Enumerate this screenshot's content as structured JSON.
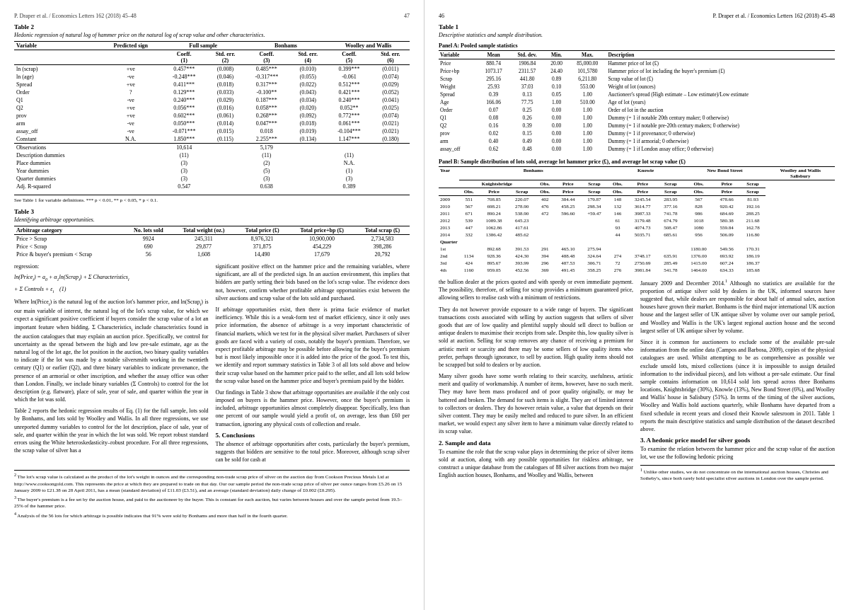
{
  "left_page": {
    "header": {
      "left": "P. Draper et al. / Economics Letters 162 (2018) 45–48",
      "right": "47"
    },
    "table2": {
      "title": "Table 2",
      "caption": "Hedonic regression of natural log of hammer price on the natural log of scrap value and other characteristics.",
      "columns": [
        "Variable",
        "Predicted sign",
        "Full sample Coeff. (1)",
        "Full sample Std. err. (2)",
        "Bonhams Coeff. (3)",
        "Bonhams Std. err. (4)",
        "Woolley and Wallis Coeff. (5)",
        "Woolley and Wallis Std. err. (6)"
      ],
      "rows": [
        [
          "ln (scrap)",
          "+ve",
          "0.457***",
          "(0.008)",
          "0.485***",
          "(0.010)",
          "0.399***",
          "(0.011)"
        ],
        [
          "ln (age)",
          "-ve",
          "-0.248***",
          "(0.046)",
          "-0.317***",
          "(0.055)",
          "-0.061",
          "(0.074)"
        ],
        [
          "Spread",
          "+ve",
          "0.411***",
          "(0.018)",
          "0.317***",
          "(0.022)",
          "0.512***",
          "(0.029)"
        ],
        [
          "Order",
          "?",
          "0.129***",
          "(0.033)",
          "-0.100**",
          "(0.043)",
          "0.421***",
          "(0.052)"
        ],
        [
          "Q1",
          "-ve",
          "0.240***",
          "(0.029)",
          "0.187***",
          "(0.034)",
          "0.240***",
          "(0.041)"
        ],
        [
          "Q2",
          "+ve",
          "0.056***",
          "(0.016)",
          "0.058***",
          "(0.020)",
          "0.052**",
          "(0.025)"
        ],
        [
          "prov",
          "+ve",
          "0.602***",
          "(0.061)",
          "0.268***",
          "(0.092)",
          "0.772***",
          "(0.074)"
        ],
        [
          "arm",
          "-ve",
          "0.050***",
          "(0.014)",
          "0.047***",
          "(0.018)",
          "0.061***",
          "(0.021)"
        ],
        [
          "assay_off",
          "-ve",
          "-0.071***",
          "(0.015)",
          "0.018",
          "(0.019)",
          "-0.104***",
          "(0.021)"
        ],
        [
          "Constant",
          "N.A.",
          "1.850***",
          "(0.115)",
          "2.255***",
          "(0.134)",
          "1.147***",
          "(0.180)"
        ],
        [
          "Observations",
          "",
          "10,614",
          "",
          "5,179",
          "",
          "",
          ""
        ],
        [
          "Description dummies",
          "",
          "(11)",
          "",
          "(11)",
          "",
          "(11)",
          ""
        ],
        [
          "Place dummies",
          "",
          "(3)",
          "",
          "(2)",
          "",
          "N.A.",
          ""
        ],
        [
          "Year dummies",
          "",
          "(3)",
          "",
          "(5)",
          "",
          "(1)",
          ""
        ],
        [
          "Quarter dummies",
          "",
          "(3)",
          "",
          "(3)",
          "",
          "(3)",
          ""
        ],
        [
          "Adj. R-squared",
          "",
          "0.547",
          "",
          "0.638",
          "",
          "0.389",
          ""
        ]
      ],
      "footnote": "See Table 1 for variable definitions. *** p < 0.01, ** p < 0.05, * p < 0.1."
    },
    "table3": {
      "title": "Table 3",
      "caption": "Identifying arbitrage opportunities.",
      "columns": [
        "Arbitrage category",
        "No. lots sold",
        "Total weight (oz.)",
        "Total price (£)",
        "Total price+bp (£)",
        "Total scrap (£)"
      ],
      "rows": [
        [
          "Price > Scrap",
          "9924",
          "245,311",
          "8,976,321",
          "10,900,000",
          "2,734,583"
        ],
        [
          "Price < Scrap",
          "690",
          "29,877",
          "371,875",
          "454,229",
          "398,286"
        ],
        [
          "Price & buyer's premium < Scrap",
          "56",
          "1,608",
          "14,490",
          "17,679",
          "20,792"
        ]
      ]
    },
    "body": {
      "regression_intro": "regression:",
      "equation1": "ln(Price_i) = a₀ + α₁ln(Scrap_i) + Σ Characteristics_i",
      "equation2": "+ Σ Controls + ε_i    (1)",
      "paragraphs": [
        "Where ln(Price_i) is the natural log of the auction lot's hammer price, and ln(Scrap_i) is our main variable of interest, the natural log of the lot's scrap value, for which we expect a significant positive coefficient if buyers consider the scrap value of a lot an important feature when bidding. Σ Characteristics_i include characteristics found in the auction catalogues that may explain an auction price. Specifically, we control for uncertainty as the spread between the high and low pre-sale estimate, age as the natural log of the lot age, the lot position in the auction, two binary quality variables to indicate if the lot was made by a notable silversmith working in the twentieth century (Q1) or earlier (Q2), and three binary variables to indicate provenance, the presence of an armorial or other inscription, and whether the assay office was other than London. Finally, we include binary variables (Σ Controls) to control for the lot description (e.g. flatware), place of sale, year of sale, and quarter within the year in which the lot was sold.",
        "Table 2 reports the hedonic regression results of Eq. (1) for the full sample, lots sold by Bonhams, and lots sold by Woolley and Wallis. In all three regressions, we use unreported dummy variables to control for the lot description, place of sale, year of sale, and quarter within the year in which the lot was sold. We report robust standard errors using the White heteroskedasticity–robust procedure. For all three regressions, the scrap value of silver has a"
      ],
      "right_column": [
        "significant positive effect on the hammer price and the remaining variables, where significant, are all of the predicted sign. In an auction environment, this implies that bidders are partly setting their bids based on the lot's scrap value. The evidence does not, however, confirm whether profitable arbitrage opportunities exist between the silver auctions and scrap value of the lots sold and purchased.",
        "If arbitrage opportunities exist, then there is prima facie evidence of market inefficiency. While this is a weak-form test of market efficiency, since it only uses price information, the absence of arbitrage is a very important characteristic of financial markets, which we test for in the physical silver market. Purchasers of silver goods are faced with a variety of costs, notably the buyer's premium. Therefore, we expect profitable arbitrage may be possible before allowing for the buyer's premium but is most likely impossible once it is added into the price of the good. To test this, we identify and report summary statistics in Table 3 of all lots sold above and below their scrap value based on the hammer price paid to the seller, and all lots sold below the scrap value based on the hammer price and buyer's premium paid by the bidder.",
        "Our findings in Table 3 show that arbitrage opportunities are available if the only cost imposed on buyers is the hammer price. However, once the buyer's premium is included, arbitrage opportunities almost completely disappear. Specifically, less than one percent of our sample would yield a profit of, on average, less than £60 per transaction, ignoring any physical costs of collection and resale."
      ],
      "section5": {
        "title": "5. Conclusions",
        "text": "The absence of arbitrage opportunities after costs, particularly the buyer's premium, suggests that bidders are sensitive to the total price. Moreover, although scrap silver can be sold for cash at"
      }
    },
    "footnotes": [
      "2 The lot's scrap value is calculated as the product of the lot's weight in ounces and the corresponding non-trade scrap price of silver on the auction day from Cookson Precious Metals Ltd at http://www.cooksongold.com. This represents the price at which they are prepared to trade on that day. Our our sample period the non-trade scrap price of silver per ounce ranges from £5.26 on 15 January 2009 to £21.38 on 28 April 2011, has a mean (standard deviation) of £11.03 (£3.51), and an average (standard deviation) daily change of £0.002 (£0.295).",
      "3 The buyer's premium is a fee set by the auction house, and paid to the auctioneer by the buyer. This is constant for each auction, but varies between houses and over the sample period from 19.5–25% of the hammer price.",
      "4 Analysis of the 56 lots for which arbitrage is possible indicates that 91% were sold by Bonhams and more than half in the fourth quarter."
    ]
  },
  "right_page": {
    "header": {
      "left": "46",
      "right": "P. Draper et al. / Economics Letters 162 (2018) 45–48"
    },
    "table1": {
      "title": "Table 1",
      "caption": "Descriptive statistics and sample distribution.",
      "panel_a": {
        "title": "Panel A: Pooled sample statistics",
        "columns": [
          "Variable",
          "Mean",
          "Std. dev.",
          "Min.",
          "Max.",
          "Description"
        ],
        "rows": [
          [
            "Price",
            "880.74",
            "1906.84",
            "20.00",
            "85,000.00",
            "Hammer price of lot (£)"
          ],
          [
            "Price+bp",
            "1073.17",
            "2311.57",
            "24.40",
            "101,5780",
            "Hammer price of lot including the buyer's premium (£)"
          ],
          [
            "Scrap",
            "295.16",
            "441.80",
            "0.89",
            "6,211.80",
            "Scrap value of lot (£)"
          ],
          [
            "Weight",
            "25.93",
            "37.03",
            "0.10",
            "553.00",
            "Weight of lot (ounces)"
          ],
          [
            "Spread",
            "0.39",
            "0.13",
            "0.05",
            "1.00",
            "Auctioneer's spread (High estimate – Low estimate)/Low estimate"
          ],
          [
            "Age",
            "166.06",
            "77.75",
            "1.00",
            "510.00",
            "Age of lot (years)"
          ],
          [
            "Order",
            "0.07",
            "0.25",
            "0.00",
            "1.00",
            "Order of lot in the auction"
          ],
          [
            "Q1",
            "0.08",
            "0.26",
            "0.00",
            "1.00",
            "Dummy (= 1 if notable 20th century maker; 0 otherwise)"
          ],
          [
            "Q2",
            "0.16",
            "0.39",
            "0.00",
            "1.00",
            "Dummy (= 1 if notable pre-20th century makers; 0 otherwise)"
          ],
          [
            "prov",
            "0.02",
            "0.15",
            "0.00",
            "1.00",
            "Dummy (= 1 if provenance; 0 otherwise)"
          ],
          [
            "arm",
            "0.40",
            "0.49",
            "0.00",
            "1.00",
            "Dummy (= 1 if armorial; 0 otherwise)"
          ],
          [
            "assay_off",
            "0.62",
            "0.48",
            "0.00",
            "1.00",
            "Dummy (= 1 if London assay office; 0 otherwise)"
          ]
        ]
      },
      "panel_b": {
        "title": "Panel B: Sample distribution of lots sold, average lot hammer price (£), and average lot scrap value (£)",
        "year_header": [
          "Year",
          "Bonhams",
          "",
          "",
          "",
          "",
          "",
          "",
          "Knowie",
          "",
          "",
          "",
          "New Bond Street",
          "",
          "",
          "",
          "Woolley and Wallis Salisbury",
          "",
          "",
          ""
        ],
        "sub_header": [
          "",
          "Knightsbridge",
          "",
          "",
          "Obs.",
          "Price",
          "Scrap",
          "Obs.",
          "Price",
          "Scrap",
          "Obs.",
          "Price",
          "Scrap",
          "Obs.",
          "Price",
          "Scrap"
        ],
        "rows": [
          [
            "2009",
            "551",
            "708.85",
            "220.07",
            "402",
            "384.44",
            "179.87",
            "148",
            "3245.54",
            "283.95",
            "567",
            "478.66",
            "81.93"
          ],
          [
            "2010",
            "567",
            "698.21",
            "278.90",
            "476",
            "458.25",
            "298.34",
            "132",
            "3614.77",
            "377.16",
            "828",
            "920.42",
            "192.16"
          ],
          [
            "2011",
            "671",
            "890.24",
            "538.90",
            "472",
            "596.60",
            "+59.47",
            "146",
            "3987.33",
            "741.78",
            "986",
            "684.69",
            "288.25"
          ],
          [
            "2012",
            "539",
            "1089.38",
            "645.23",
            "",
            "",
            "",
            "61",
            "3179.48",
            "674.79",
            "1018",
            "580.38",
            "211.68"
          ],
          [
            "2013",
            "447",
            "1062.86",
            "417.61",
            "",
            "",
            "",
            "93",
            "4074.73",
            "508.47",
            "1080",
            "559.84",
            "162.78"
          ],
          [
            "2014",
            "332",
            "1386.42",
            "485.62",
            "",
            "",
            "",
            "44",
            "5035.71",
            "685.61",
            "956",
            "506.09",
            "116.80"
          ],
          [
            "Quarter",
            "",
            "",
            "",
            "",
            "",
            "",
            "",
            "",
            "",
            "",
            "",
            "",
            "",
            "",
            ""
          ],
          [
            "1st",
            "",
            "892.68",
            "391.53",
            "291",
            "465.10",
            "275.94",
            "",
            "",
            "",
            "1180.00",
            "549.56",
            "170.31"
          ],
          [
            "2nd",
            "1134",
            "928.36",
            "424.30",
            "394",
            "488.48",
            "324.64",
            "274",
            "3748.17",
            "635.91",
            "1376.00",
            "693.92",
            "186.19"
          ],
          [
            "3rd",
            "424",
            "895.67",
            "393.99",
            "296",
            "487.53",
            "306.71",
            "72",
            "2750.69",
            "285.49",
            "1415.00",
            "607.24",
            "186.37"
          ],
          [
            "4th",
            "1160",
            "959.05",
            "452.56",
            "369",
            "491.45",
            "358.25",
            "276",
            "3981.84",
            "541.78",
            "1464.00",
            "634.33",
            "185.68"
          ]
        ]
      }
    },
    "body": {
      "paragraphs_left": [
        "the bullion dealer at the prices quoted and with speedy or even immediate payment. The possibility, therefore, of selling for scrap provides a minimum guaranteed price, allowing sellers to realise cash with a minimum of restrictions.",
        "They do not however provide exposure to a wide range of buyers. The significant transactions costs associated with selling by auction suggests that sellers of silver goods that are of low quality and plentiful supply should sell direct to bullion or antique dealers to maximise their receipts from sale. Despite this, low quality silver is sold at auction. Selling for scrap removes any chance of receiving a premium for artistic merit or scarcity and there may be some sellers of low quality items who prefer, perhaps through ignorance, to sell by auction. High quality items should not be scrapped but sold to dealers or by auction.",
        "Many silver goods have some worth relating to their scarcity, usefulness, artistic merit and quality of workmanship. A number of items, however, have no such merit. They may have been mass produced and of poor quality originally, or may be battered and broken. The demand for such items is slight. They are of limited interest to collectors or dealers. They do however retain value, a value that depends on their silver content. They may be easily melted and reduced to pure silver. In an efficient market, we would expect any silver item to have a minimum value directly related to its scrap value."
      ],
      "section2": {
        "title": "2. Sample and data",
        "text": "To examine the role that the scrap value plays in determining the price of silver items sold at auction, along with any possible opportunities for riskless arbitrage, we construct a unique database from the catalogues of 88 silver auctions from two major English auction houses, Bonhams, and Woolley and Wallis, between"
      },
      "paragraphs_right": [
        "January 2009 and December 2014. Although no statistics are available for the proportion of antique silver sold by dealers in the UK, informed sources have suggested that, while dealers are responsible for about half of annual sales, auction houses have grown their market. Bonhams is the third major international UK auction house and the largest seller of UK antique silver by volume over our sample period, and Woolley and Wallis is the UK's largest regional auction house and the second largest seller of UK antique silver by volume.",
        "Since it is common for auctioneers to exclude some of the available pre-sale information from the online data (Campos and Barbosa, 2009), copies of the physical catalogues are used. Whilst attempting to be as comprehensive as possible we exclude unsold lots, mixed collections (since it is impossible to assign detailed information to the individual pieces), and lots without a pre-sale estimate. Our final sample contains information on 10,614 sold lots spread across three Bonhams locations, Knightsbridge (30%), Knowle (13%), New Bond Street (6%), and Woolley and Wallis' house in Salisbury (51%). In terms of the timing of the silver auctions, Woolley and Wallis hold auctions quarterly, while Bonhams have departed from a fixed schedule in recent years and closed their Knowle salesroom in 2011. Table 1 reports the main descriptive statistics and sample distribution of the dataset described above."
      ],
      "section3": {
        "title": "3. A hedonic price model for silver goods",
        "text": "To examine the relation between the hammer price and the scrap value of the auction lot, we use the following hedonic pricing"
      }
    },
    "footnotes": [
      "1 Unlike other studies, we do not concentrate on the international auction houses, Christies and Sotheby's, since both rarely hold specialist silver auctions in London over the sample period."
    ]
  }
}
